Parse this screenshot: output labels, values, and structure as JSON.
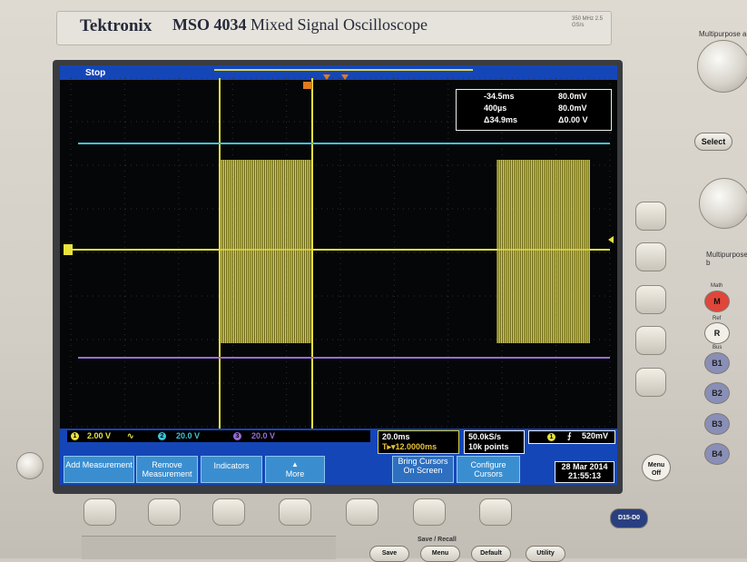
{
  "header": {
    "brand": "Tektronix",
    "model": "MSO 4034",
    "description": "Mixed Signal Oscilloscope",
    "bandwidth": "350 MHz 2.5 GS/s"
  },
  "status": {
    "run_state": "Stop"
  },
  "cursor_readout": {
    "rows": [
      {
        "left": "-34.5ms",
        "right": "80.0mV"
      },
      {
        "left": "400µs",
        "right": "80.0mV"
      },
      {
        "left": "Δ34.9ms",
        "right": "Δ0.00 V"
      }
    ]
  },
  "channels": [
    {
      "num": "1",
      "scale": "2.00 V",
      "coupling": "∿",
      "color": "#e8e23c"
    },
    {
      "num": "2",
      "scale": "20.0 V",
      "color": "#3fc3d8"
    },
    {
      "num": "3",
      "scale": "20.0 V",
      "color": "#9a6bd6"
    }
  ],
  "timebase": {
    "scale": "20.0ms",
    "delay": "T▸▾12.0000ms"
  },
  "sample": {
    "rate": "50.0kS/s",
    "points": "10k points"
  },
  "trigger": {
    "source": "1",
    "slope": "⨍",
    "level": "520mV"
  },
  "menu": [
    {
      "label": "Add Measurement"
    },
    {
      "label": "Remove Measurement"
    },
    {
      "label": "Indicators"
    },
    {
      "label": "More"
    },
    {
      "label": "Bring Cursors On Screen"
    },
    {
      "label": "Configure Cursors"
    }
  ],
  "datetime": {
    "date": "28 Mar 2014",
    "time": "21:55:13"
  },
  "panel": {
    "multipurpose_a": "Multipurpose a",
    "multipurpose_b": "Multipurpose b",
    "select": "Select",
    "math_label": "Math",
    "math": "M",
    "ref_label": "Ref",
    "ref": "R",
    "bus_label": "Bus",
    "bus_buttons": [
      "B1",
      "B2",
      "B3",
      "B4"
    ],
    "menu_off": "Menu Off",
    "digital": "D15-D0",
    "save_recall": "Save / Recall",
    "save": "Save",
    "menu_btn": "Menu",
    "default": "Default",
    "utility": "Utility"
  },
  "colors": {
    "ch1": "#e8e23c",
    "ch2": "#3fc3d8",
    "ch3": "#9a6bd6",
    "status_bar": "#1546b8",
    "menu": "#3a8ed0",
    "math": "#e0463a"
  }
}
